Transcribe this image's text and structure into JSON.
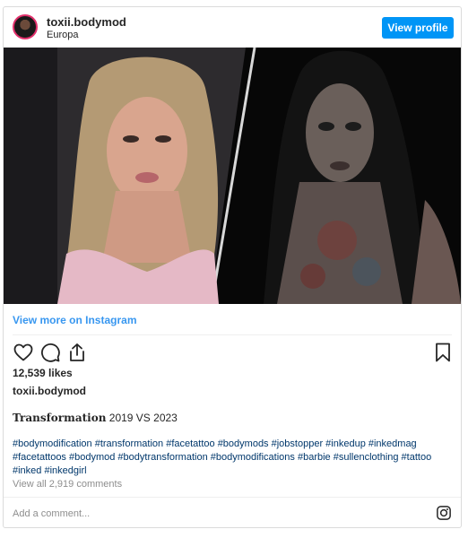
{
  "post": {
    "username": "toxii.bodymod",
    "location": "Europa",
    "view_profile_label": "View profile",
    "view_more_label": "View more on Instagram",
    "likes": "12,539 likes",
    "caption_username": "toxii.bodymod",
    "caption_title": "Transformation",
    "caption_rest": " 2019 VS 2023",
    "hashtags": "#bodymodification #transformation #facetattoo #bodymods #jobstopper #inkedup #inkedmag #facetattoos #bodymod #bodytransformation #bodymodifications #barbie #sullenclothing #tattoo #inked #inkedgirl",
    "view_all_comments": "View all 2,919 comments",
    "add_comment_placeholder": "Add a comment..."
  },
  "icons": {
    "like": "heart-icon",
    "comment": "comment-icon",
    "share": "share-icon",
    "save": "bookmark-icon",
    "instagram": "instagram-icon"
  },
  "colors": {
    "accent_blue": "#0095f6",
    "link_blue": "#3897f0",
    "hashtag_blue": "#00376b",
    "muted_text": "#8e8e8e"
  }
}
